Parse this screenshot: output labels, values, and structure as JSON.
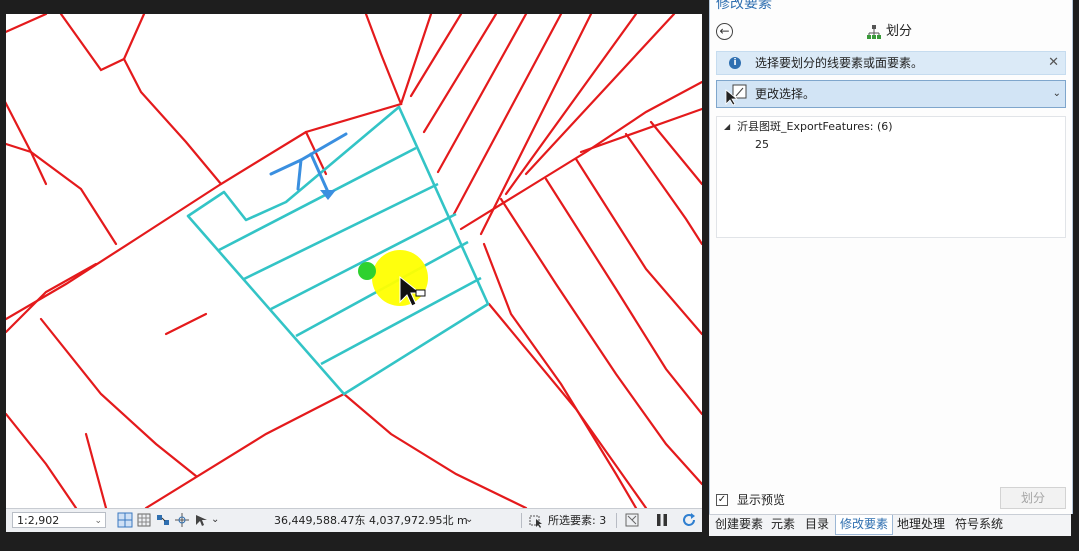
{
  "pane": {
    "title_strip": "修改要素",
    "tool_title": "划分",
    "info_message": "选择要划分的线要素或面要素。",
    "select_label": "更改选择。",
    "layer_entry": "沂县图斑_ExportFeatures: (6)",
    "feature_oid": "25",
    "preview_label": "显示预览",
    "preview_checked": "✓",
    "split_button": "划分",
    "close_glyph": "✕",
    "back_glyph": "←",
    "chevron_glyph": "⌄"
  },
  "statusbar": {
    "scale": "1:2,902",
    "coordinates": "36,449,588.47东 4,037,972.95北 m",
    "selected_features": "所选要素: 3"
  },
  "tabs": [
    {
      "label": "创建要素",
      "active": false
    },
    {
      "label": "元素",
      "active": false
    },
    {
      "label": "目录",
      "active": false
    },
    {
      "label": "修改要素",
      "active": true
    },
    {
      "label": "地理处理",
      "active": false
    },
    {
      "label": "符号系统",
      "active": false
    }
  ],
  "colors": {
    "parcel_line": "#e41a1c",
    "selected_outline": "#33c4c6",
    "split_sketch": "#3a8fe0",
    "pointer_highlight": "#ffff00",
    "snap_point": "#2ed12e"
  },
  "icons": [
    "info-icon",
    "split-icon",
    "select-pointer-icon",
    "pause-icon",
    "refresh-icon",
    "filter-icon",
    "grid-icon",
    "snap-icon",
    "navigation-icon"
  ]
}
